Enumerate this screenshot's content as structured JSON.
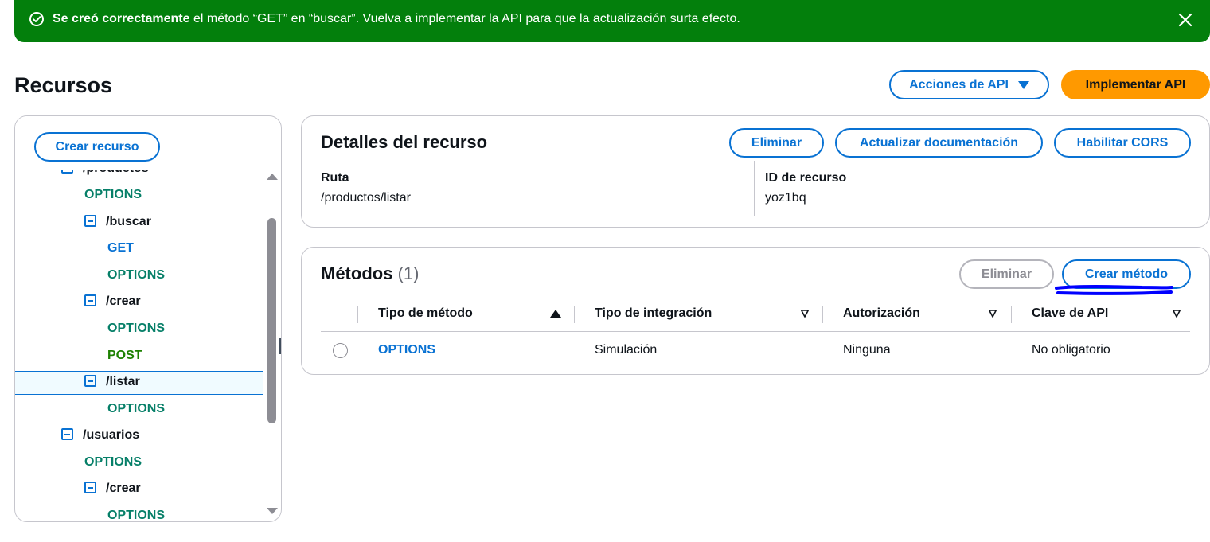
{
  "flash": {
    "message_bold": "Se creó correctamente",
    "message_rest": " el método “GET” en “buscar”. Vuelva a implementar la API para que la actualización surta efecto.",
    "icons": [
      "success-icon",
      "close-icon"
    ],
    "color": "#037f0c"
  },
  "header": {
    "title": "Recursos",
    "api_actions_label": "Acciones de API",
    "deploy_label": "Implementar API"
  },
  "tree": {
    "create_resource_label": "Crear recurso",
    "nodes": [
      {
        "label": "/productos"
      },
      {
        "label": "OPTIONS"
      },
      {
        "label": "/buscar"
      },
      {
        "label": "GET"
      },
      {
        "label": "OPTIONS"
      },
      {
        "label": "/crear"
      },
      {
        "label": "OPTIONS"
      },
      {
        "label": "POST"
      },
      {
        "label": "/listar"
      },
      {
        "label": "OPTIONS"
      },
      {
        "label": "/usuarios"
      },
      {
        "label": "OPTIONS"
      },
      {
        "label": "/crear"
      },
      {
        "label": "OPTIONS"
      }
    ],
    "selected": "/listar"
  },
  "details": {
    "title": "Detalles del recurso",
    "delete_label": "Eliminar",
    "update_docs_label": "Actualizar documentación",
    "enable_cors_label": "Habilitar CORS",
    "path_key": "Ruta",
    "path_value": "/productos/listar",
    "id_key": "ID de recurso",
    "id_value": "yoz1bq"
  },
  "methods": {
    "title": "Métodos",
    "count": "(1)",
    "delete_label": "Eliminar",
    "create_label": "Crear método",
    "columns": [
      "Tipo de método",
      "Tipo de integración",
      "Autorización",
      "Clave de API"
    ],
    "rows": [
      {
        "method": "OPTIONS",
        "integration": "Simulación",
        "authorization": "Ninguna",
        "api_key": "No obligatorio"
      }
    ]
  },
  "colors": {
    "accent": "#0972d3",
    "primary_button": "#ff9900",
    "options_method": "#067f68",
    "post_method": "#1d8102",
    "annotation": "#0000ff"
  }
}
